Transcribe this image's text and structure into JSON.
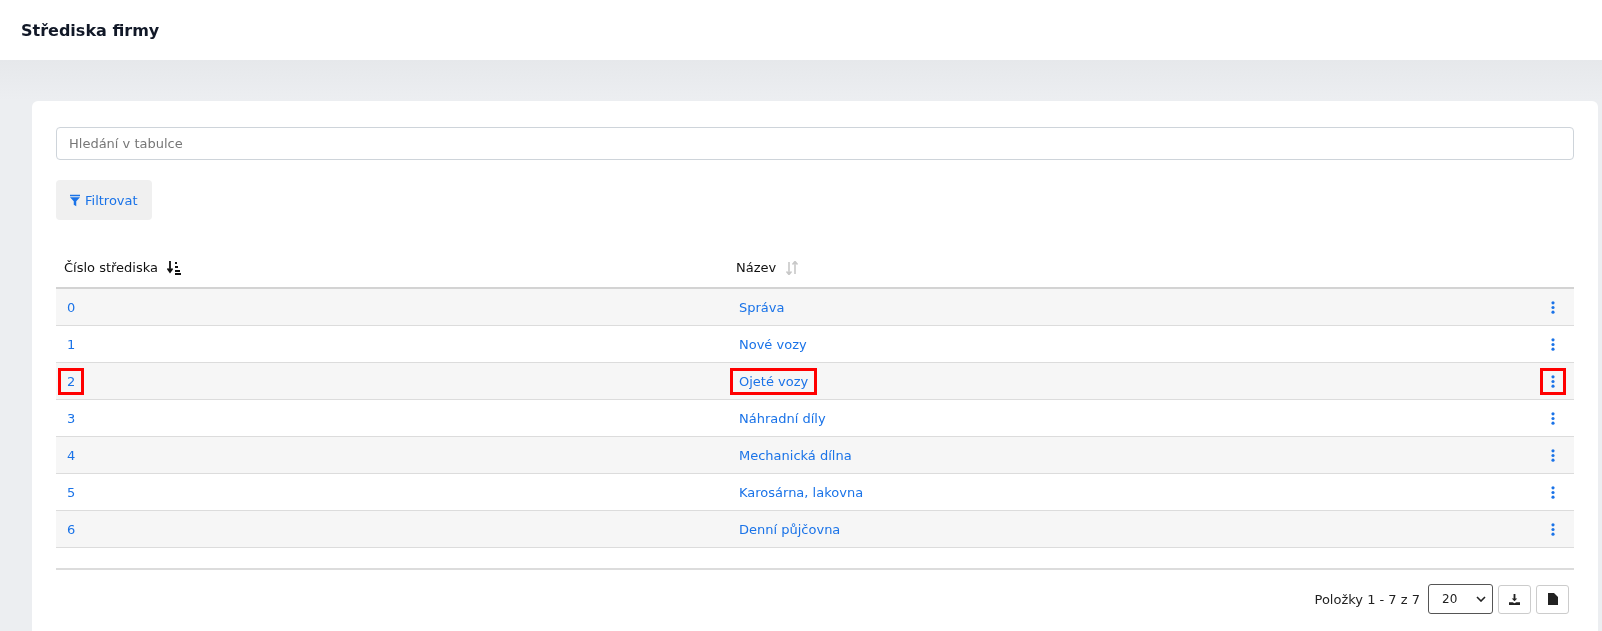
{
  "header": {
    "title": "Střediska firmy"
  },
  "search": {
    "placeholder": "Hledání v tabulce"
  },
  "filter_button": {
    "label": "Filtrovat"
  },
  "table": {
    "columns": [
      {
        "label": "Číslo střediska",
        "sorted": true
      },
      {
        "label": "Název",
        "sorted": false
      }
    ],
    "rows": [
      {
        "number": "0",
        "name": "Správa",
        "highlighted": false
      },
      {
        "number": "1",
        "name": "Nové vozy",
        "highlighted": false
      },
      {
        "number": "2",
        "name": "Ojeté vozy",
        "highlighted": true
      },
      {
        "number": "3",
        "name": "Náhradní díly",
        "highlighted": false
      },
      {
        "number": "4",
        "name": "Mechanická dílna",
        "highlighted": false
      },
      {
        "number": "5",
        "name": "Karosárna, lakovna",
        "highlighted": false
      },
      {
        "number": "6",
        "name": "Denní půjčovna",
        "highlighted": false
      }
    ]
  },
  "footer": {
    "range": "Položky 1 - 7 z 7",
    "page_size": "20"
  }
}
